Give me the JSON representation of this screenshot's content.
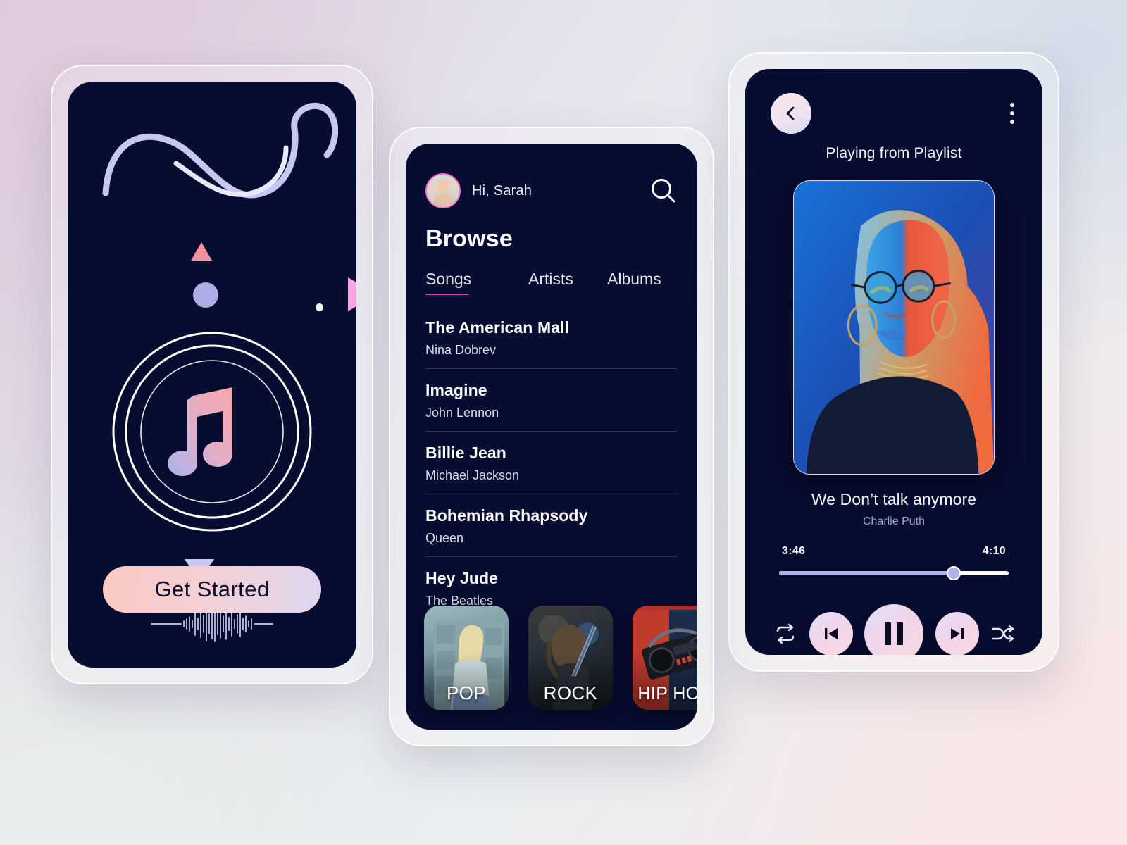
{
  "theme": {
    "screen_bg": "#070c31",
    "accent_pink": "#c851b4",
    "avatar_ring": "#f46fd0",
    "gradient_start": "#fbc9c2",
    "gradient_end": "#ded7ef",
    "progress_fill": "#b0b2ec"
  },
  "onboarding": {
    "cta_label": "Get Started",
    "icons": {
      "note": "music-note-icon",
      "waveform": "audio-waveform-icon",
      "squiggle": "wave-squiggle-decoration"
    }
  },
  "browse": {
    "greeting": "Hi, Sarah",
    "search_icon": "search-icon",
    "title": "Browse",
    "tabs": [
      {
        "label": "Songs",
        "active": true
      },
      {
        "label": "Artists",
        "active": false
      },
      {
        "label": "Albums",
        "active": false
      }
    ],
    "songs": [
      {
        "title": "The American Mall",
        "artist": "Nina Dobrev"
      },
      {
        "title": "Imagine",
        "artist": "John Lennon"
      },
      {
        "title": "Billie Jean",
        "artist": "Michael Jackson"
      },
      {
        "title": "Bohemian Rhapsody",
        "artist": "Queen"
      },
      {
        "title": "Hey Jude",
        "artist": "The Beatles"
      }
    ],
    "genres": [
      {
        "label": "POP"
      },
      {
        "label": "ROCK"
      },
      {
        "label": "HIP HOP"
      }
    ]
  },
  "player": {
    "back_icon": "chevron-left-icon",
    "menu_icon": "kebab-menu-icon",
    "source_label": "Playing from Playlist",
    "track_title": "We Don’t talk anymore",
    "track_artist": "Charlie Puth",
    "elapsed": "3:46",
    "duration": "4:10",
    "progress_percent": 76,
    "controls": {
      "repeat": "repeat-icon",
      "previous": "previous-track-icon",
      "play_pause": "pause-icon",
      "next": "next-track-icon",
      "shuffle": "shuffle-icon"
    }
  }
}
